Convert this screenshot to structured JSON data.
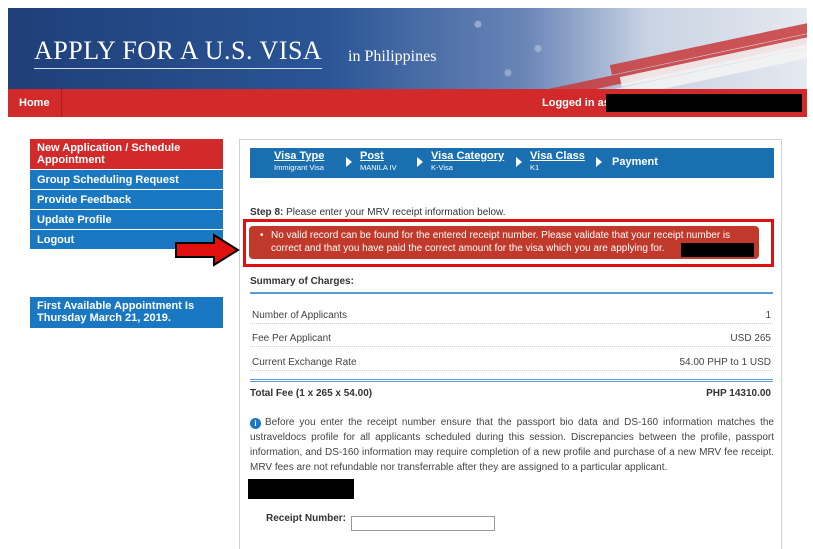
{
  "header": {
    "title": "APPLY FOR A U.S. VISA",
    "country": "in Philippines"
  },
  "navbar": {
    "home": "Home",
    "logged_in": "Logged in as"
  },
  "sidebar": {
    "items": [
      {
        "label": "New Application / Schedule Appointment"
      },
      {
        "label": "Group Scheduling Request"
      },
      {
        "label": "Provide Feedback"
      },
      {
        "label": "Update Profile"
      },
      {
        "label": "Logout"
      }
    ],
    "appointment_notice": "First Available Appointment Is Thursday March 21, 2019."
  },
  "steps": [
    {
      "label": "Visa Type",
      "value": "Immigrant Visa"
    },
    {
      "label": "Post",
      "value": "MANILA IV"
    },
    {
      "label": "Visa Category",
      "value": "K-Visa"
    },
    {
      "label": "Visa Class",
      "value": "K1"
    },
    {
      "label": "Payment",
      "value": ""
    }
  ],
  "step8": {
    "prefix": "Step 8:",
    "text": "Please enter your MRV receipt information below."
  },
  "error": {
    "message": "No valid record can be found for the entered receipt number. Please validate that your receipt number is correct and that you have paid the correct amount for the visa which you are applying for."
  },
  "summary": {
    "title": "Summary of Charges:",
    "rows": [
      {
        "label": "Number of Applicants",
        "value": "1"
      },
      {
        "label": "Fee Per Applicant",
        "value": "USD 265"
      },
      {
        "label": "Current Exchange Rate",
        "value": "54.00 PHP to 1 USD"
      }
    ],
    "total_label": "Total Fee (1 x 265 x 54.00)",
    "total_value": "PHP 14310.00"
  },
  "info": {
    "icon": "info-icon",
    "text": "Before you enter the receipt number ensure that the passport bio data and DS-160 information matches the ustraveldocs profile for all applicants scheduled during this session. Discrepancies between the profile, passport information, and DS-160 information may require completion of a new profile and purchase of a new MRV fee receipt. MRV fees are not refundable nor transferrable after they are assigned to a particular applicant."
  },
  "receipt": {
    "label": "Receipt Number:",
    "value": "",
    "placeholder": ""
  },
  "colors": {
    "nav_red": "#d22a2a",
    "menu_blue": "#1a78c2",
    "error_red": "#c0392b",
    "steps_blue": "#1a6fb0"
  }
}
